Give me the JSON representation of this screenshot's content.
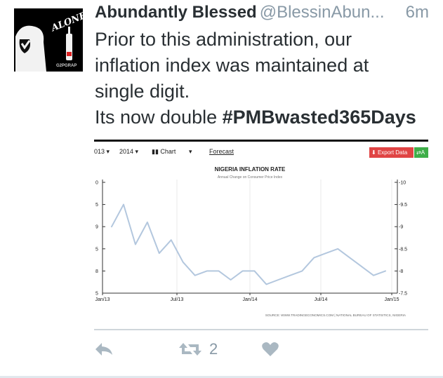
{
  "tweet": {
    "display_name": "Abundantly Blessed",
    "handle": "@BlessinAbun...",
    "time": "6m",
    "lines": [
      "Prior to this administration, our",
      "inflation index was maintained at",
      "single digit."
    ],
    "line4_prefix": "Its now double ",
    "hashtag": "#PMBwasted365Days",
    "avatar_text": "ALONE",
    "avatar_watermark": "G2PGRAP",
    "retweet_count": "2",
    "icons": [
      "reply-icon",
      "retweet-icon",
      "like-icon"
    ]
  },
  "toolbar": {
    "start_year": "013",
    "end_year": "2014",
    "chart_label": "Chart",
    "forecast_label": "Forecast",
    "export_label": "Export Data",
    "extra_label": "A"
  },
  "colors": {
    "line": "#b3c7de",
    "export": "#e04444",
    "add": "#3fae49",
    "name": "#292f33",
    "muted": "#8899a6"
  },
  "chart_data": {
    "type": "line",
    "title": "NIGERIA INFLATION RATE",
    "subtitle": "Annual Change on Consumer Price Index",
    "source": "SOURCE: WWW.TRADINGECONOMICS.COM | NATIONAL BUREAU OF STATISTICS, NIGERIA",
    "x_ticks": [
      "Jan/13",
      "Jul/13",
      "Jan/14",
      "Jul/14",
      "Jan/15"
    ],
    "left_tick_labels": [
      "0",
      "5",
      "9",
      "5",
      "8",
      "5"
    ],
    "right_tick_labels": [
      "10",
      "9.5",
      "9",
      "8.5",
      "8",
      "7.5"
    ],
    "ylim": [
      7.5,
      10
    ],
    "x": [
      "2013-01",
      "2013-02",
      "2013-03",
      "2013-04",
      "2013-05",
      "2013-06",
      "2013-07",
      "2013-08",
      "2013-09",
      "2013-10",
      "2013-11",
      "2013-12",
      "2014-01",
      "2014-02",
      "2014-03",
      "2014-04",
      "2014-05",
      "2014-06",
      "2014-07",
      "2014-08",
      "2014-09",
      "2014-10",
      "2014-11",
      "2014-12"
    ],
    "values": [
      9.0,
      9.5,
      8.6,
      9.1,
      8.4,
      8.7,
      8.2,
      7.9,
      8.0,
      8.0,
      7.8,
      8.0,
      8.0,
      7.7,
      7.8,
      7.9,
      8.0,
      8.3,
      8.4,
      8.5,
      8.3,
      8.1,
      7.9,
      8.0
    ],
    "grid": "vertical"
  }
}
